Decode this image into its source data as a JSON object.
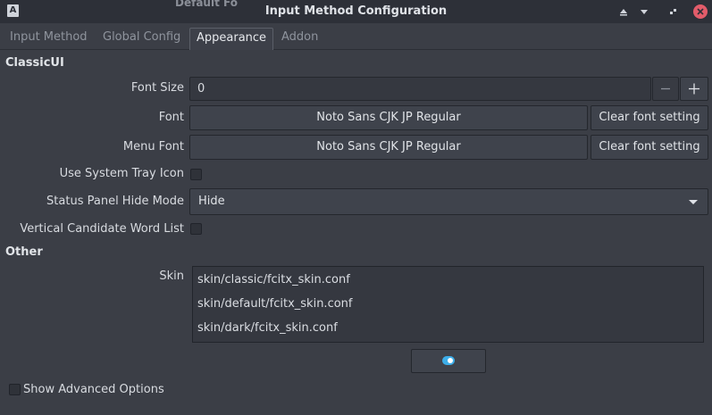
{
  "window": {
    "title": "Input Method Configuration",
    "ghost_text": "Default Fo"
  },
  "tabs": [
    {
      "label": "Input Method",
      "active": false
    },
    {
      "label": "Global Config",
      "active": false
    },
    {
      "label": "Appearance",
      "active": true
    },
    {
      "label": "Addon",
      "active": false
    }
  ],
  "classic_ui": {
    "section_title": "ClassicUI",
    "font_size_label": "Font Size",
    "font_size_value": "0",
    "font_label": "Font",
    "font_value": "Noto Sans CJK JP Regular",
    "clear_font_label": "Clear font setting",
    "menu_font_label": "Menu Font",
    "menu_font_value": "Noto Sans CJK JP Regular",
    "clear_menu_font_label": "Clear font setting",
    "system_tray_label": "Use System Tray Icon",
    "status_panel_label": "Status Panel Hide Mode",
    "status_panel_value": "Hide",
    "vertical_list_label": "Vertical Candidate Word List"
  },
  "other": {
    "section_title": "Other",
    "skin_label": "Skin",
    "skins": [
      "skin/classic/fcitx_skin.conf",
      "skin/default/fcitx_skin.conf",
      "skin/dark/fcitx_skin.conf"
    ]
  },
  "footer": {
    "show_advanced_label": "Show Advanced Options"
  },
  "icons": {
    "app": "app-icon",
    "minimize_up": "triangle-up-icon",
    "minimize": "minimize-icon",
    "restore": "restore-icon",
    "close": "close-icon",
    "decrement": "minus-icon",
    "increment": "plus-icon",
    "dropdown": "chevron-down-icon"
  },
  "colors": {
    "accent": "#3daee9",
    "close_button": "#e25c6a",
    "background": "#3b3e46",
    "titlebar": "#2d3038"
  }
}
